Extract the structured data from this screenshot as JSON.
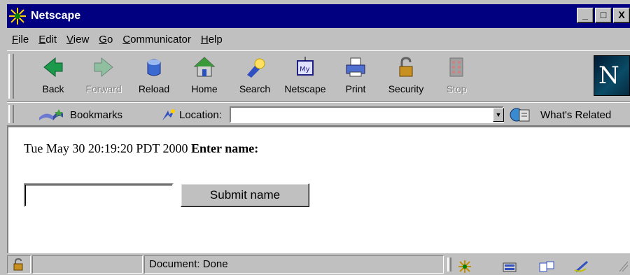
{
  "window": {
    "title": "Netscape",
    "controls": [
      "_",
      "□",
      "X"
    ]
  },
  "menubar": [
    {
      "label": "File",
      "accel": "F"
    },
    {
      "label": "Edit",
      "accel": "E"
    },
    {
      "label": "View",
      "accel": "V"
    },
    {
      "label": "Go",
      "accel": "G"
    },
    {
      "label": "Communicator",
      "accel": "C"
    },
    {
      "label": "Help",
      "accel": "H"
    }
  ],
  "toolbar": {
    "buttons": [
      {
        "label": "Back",
        "icon": "back-arrow-icon",
        "enabled": true
      },
      {
        "label": "Forward",
        "icon": "forward-arrow-icon",
        "enabled": false
      },
      {
        "label": "Reload",
        "icon": "reload-icon",
        "enabled": true
      },
      {
        "label": "Home",
        "icon": "home-icon",
        "enabled": true
      },
      {
        "label": "Search",
        "icon": "search-flashlight-icon",
        "enabled": true
      },
      {
        "label": "Netscape",
        "icon": "my-netscape-icon",
        "enabled": true
      },
      {
        "label": "Print",
        "icon": "printer-icon",
        "enabled": true
      },
      {
        "label": "Security",
        "icon": "padlock-icon",
        "enabled": true
      },
      {
        "label": "Stop",
        "icon": "stop-icon",
        "enabled": false
      }
    ],
    "logo": "N"
  },
  "locationbar": {
    "bookmarks_label": "Bookmarks",
    "location_label": "Location:",
    "location_value": "",
    "related_label": "What's Related"
  },
  "content": {
    "timestamp": "Tue May 30 20:19:20 PDT 2000",
    "prompt": "Enter name:",
    "name_value": "",
    "submit_label": "Submit name"
  },
  "statusbar": {
    "text": "Document: Done"
  }
}
